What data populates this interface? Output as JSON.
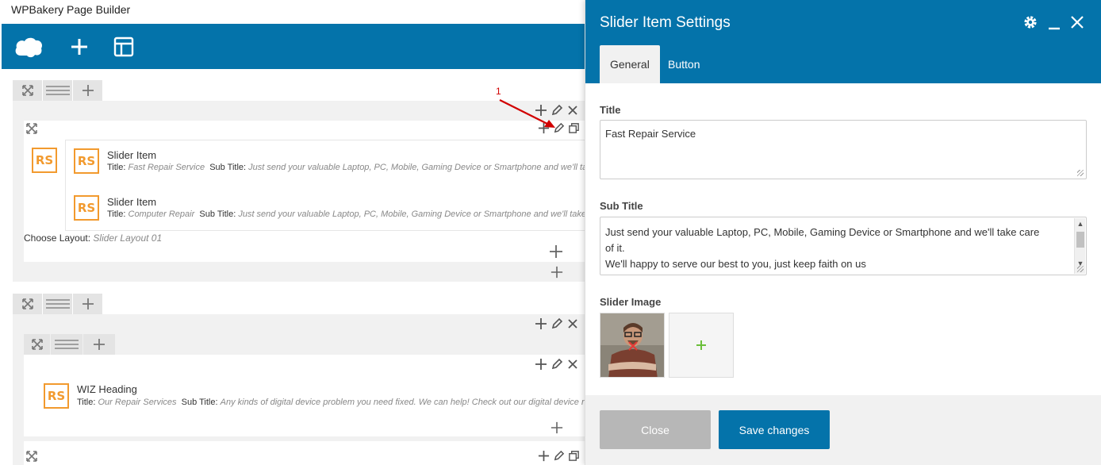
{
  "builder": {
    "title": "WPBakery Page Builder",
    "toolbar": {
      "logo_icon": "cloud-logo-icon",
      "add_icon": "plus-icon",
      "templates_icon": "layout-template-icon"
    },
    "row1": {
      "elements": [
        {
          "name": "Slider Item",
          "title_label": "Title",
          "title_value": "Fast Repair Service",
          "subtitle_label": "Sub Title",
          "subtitle_value": "Just send your valuable Laptop, PC, Mobile, Gaming Device or Smartphone and we'll take ca"
        },
        {
          "name": "Slider Item",
          "title_label": "Title",
          "title_value": "Computer Repair",
          "subtitle_label": "Sub Title",
          "subtitle_value": "Just send your valuable Laptop, PC, Mobile, Gaming Device or Smartphone and we'll take care"
        }
      ],
      "layout_label": "Choose Layout",
      "layout_value": "Slider Layout 01"
    },
    "row2": {
      "element": {
        "name": "WIZ Heading",
        "title_label": "Title",
        "title_value": "Our Repair Services",
        "subtitle_label": "Sub Title",
        "subtitle_value": "Any kinds of digital device problem you need fixed. We can help! Check out our digital device repai"
      }
    },
    "logo_text": "RS",
    "annotation": "1"
  },
  "panel": {
    "title": "Slider Item Settings",
    "tabs": [
      {
        "label": "General",
        "active": true
      },
      {
        "label": "Button",
        "active": false
      }
    ],
    "fields": {
      "title_label": "Title",
      "title_value": "Fast Repair Service",
      "subtitle_label": "Sub Title",
      "subtitle_line1": "Just send your valuable Laptop, PC, Mobile, Gaming Device or Smartphone and we'll take care",
      "subtitle_line2": "of it.",
      "subtitle_line3": "We'll happy to serve our best to you, just keep faith on us",
      "image_label": "Slider Image"
    },
    "buttons": {
      "close": "Close",
      "save": "Save changes"
    },
    "colors": {
      "brand": "#0473aa",
      "logo_orange": "#f29a2e",
      "add_green": "#6bbf3b"
    }
  }
}
